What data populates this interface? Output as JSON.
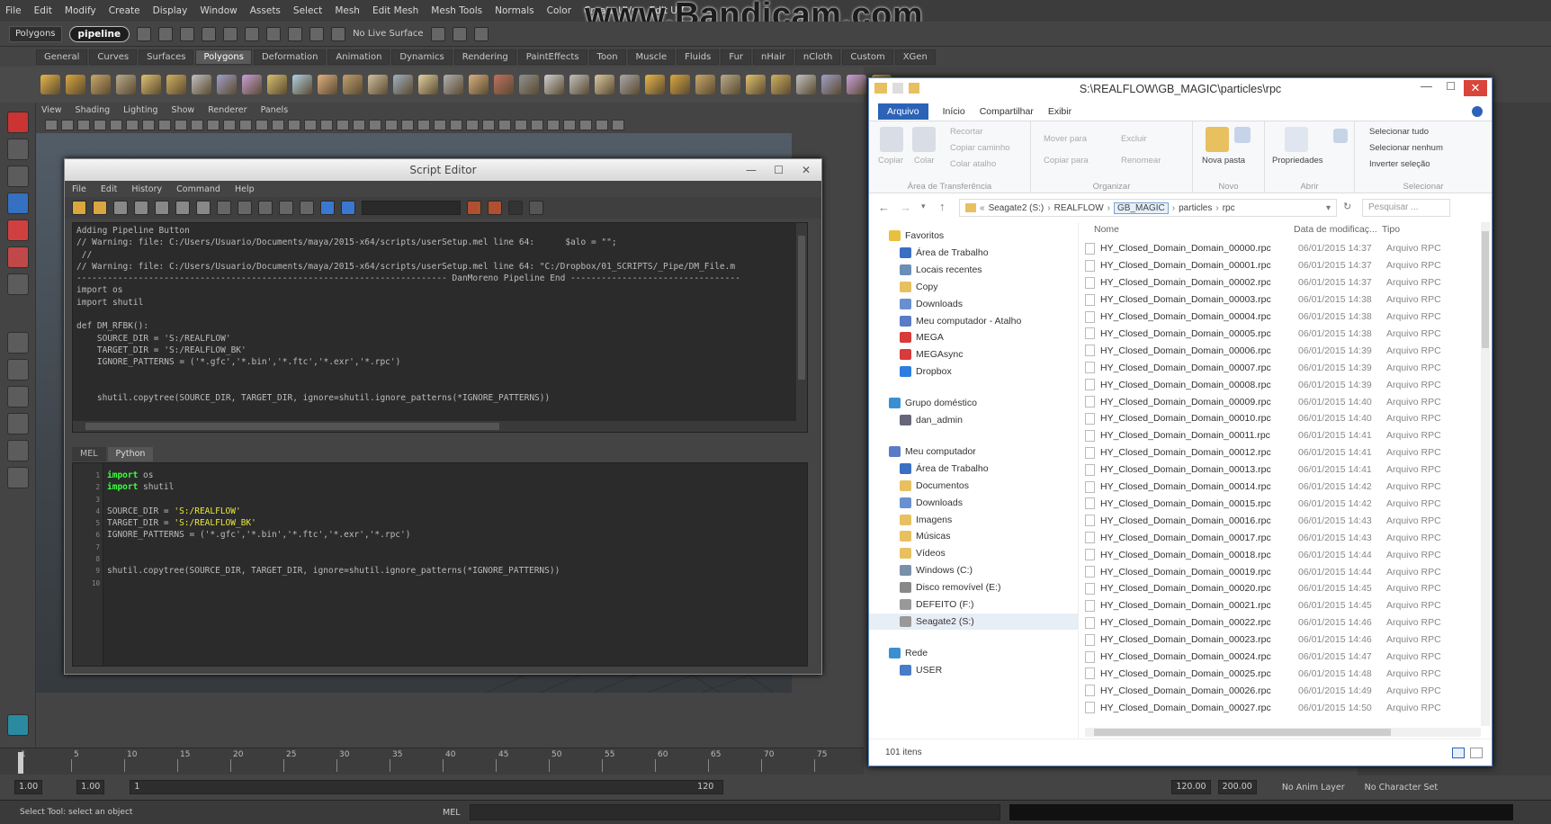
{
  "maya": {
    "menu": [
      "File",
      "Edit",
      "Modify",
      "Create",
      "Display",
      "Window",
      "Assets",
      "Select",
      "Mesh",
      "Edit Mesh",
      "Mesh Tools",
      "Normals",
      "Color",
      "Create UVs",
      "Edit UV"
    ],
    "watermark": "www.Bandicam.com",
    "mode_dropdown": "Polygons",
    "pipeline_label": "pipeline",
    "live_surface": "No Live Surface",
    "shelf_tabs": [
      "General",
      "Curves",
      "Surfaces",
      "Polygons",
      "Deformation",
      "Animation",
      "Dynamics",
      "Rendering",
      "PaintEffects",
      "Toon",
      "Muscle",
      "Fluids",
      "Fur",
      "nHair",
      "nCloth",
      "Custom",
      "XGen"
    ],
    "panel_menu": [
      "View",
      "Shading",
      "Lighting",
      "Show",
      "Renderer",
      "Panels"
    ],
    "timeline_ticks": [
      "1",
      "5",
      "10",
      "15",
      "20",
      "25",
      "30",
      "35",
      "40",
      "45",
      "50",
      "55",
      "60",
      "65",
      "70",
      "75"
    ],
    "range": {
      "start": "1.00",
      "start2": "1.00",
      "frame": "1",
      "end_marker": "120",
      "end": "120.00",
      "end2": "200.00"
    },
    "anim_layer": "No Anim Layer",
    "char_set": "No Character Set",
    "help_line": "Select Tool: select an object",
    "cmd_lang": "MEL"
  },
  "script_editor": {
    "title": "Script Editor",
    "menu": [
      "File",
      "Edit",
      "History",
      "Command",
      "Help"
    ],
    "tabs": [
      "MEL",
      "Python"
    ],
    "active_tab": "Python",
    "output": "Adding Pipeline Button\n// Warning: file: C:/Users/Usuario/Documents/maya/2015-x64/scripts/userSetup.mel line 64:      $alo = \"\";\n //\n// Warning: file: C:/Users/Usuario/Documents/maya/2015-x64/scripts/userSetup.mel line 64: \"C:/Dropbox/01_SCRIPTS/_Pipe/DM_File.m\n------------------------------------------------------------------------ DanMoreno Pipeline End ---------------------------------\nimport os\nimport shutil\n\ndef DM_RFBK():\n    SOURCE_DIR = 'S:/REALFLOW'\n    TARGET_DIR = 'S:/REALFLOW_BK'\n    IGNORE_PATTERNS = ('*.gfc','*.bin','*.ftc','*.exr','*.rpc')\n\n\n    shutil.copytree(SOURCE_DIR, TARGET_DIR, ignore=shutil.ignore_patterns(*IGNORE_PATTERNS))",
    "input_lines": [
      {
        "n": "1",
        "kw": "import",
        "rest": " os"
      },
      {
        "n": "2",
        "kw": "import",
        "rest": " shutil"
      },
      {
        "n": "3",
        "kw": "",
        "rest": ""
      },
      {
        "n": "4",
        "kw": "",
        "rest": "SOURCE_DIR = ",
        "str": "'S:/REALFLOW'"
      },
      {
        "n": "5",
        "kw": "",
        "rest": "TARGET_DIR = ",
        "str": "'S:/REALFLOW_BK'"
      },
      {
        "n": "6",
        "kw": "",
        "rest": "IGNORE_PATTERNS = ('*.gfc','*.bin','*.ftc','*.exr','*.rpc')"
      },
      {
        "n": "7",
        "kw": "",
        "rest": ""
      },
      {
        "n": "8",
        "kw": "",
        "rest": ""
      },
      {
        "n": "9",
        "kw": "",
        "rest": "shutil.copytree(SOURCE_DIR, TARGET_DIR, ignore=shutil.ignore_patterns(*IGNORE_PATTERNS))"
      },
      {
        "n": "10",
        "kw": "",
        "rest": ""
      }
    ]
  },
  "explorer": {
    "title": "S:\\REALFLOW\\GB_MAGIC\\particles\\rpc",
    "tabs": [
      "Arquivo",
      "Início",
      "Compartilhar",
      "Exibir"
    ],
    "ribbon": {
      "copiar": "Copiar",
      "colar": "Colar",
      "recortar": "Recortar",
      "copiar_caminho": "Copiar caminho",
      "colar_atalho": "Colar atalho",
      "grp_transfer": "Área de Transferência",
      "mover": "Mover para",
      "copiar_para": "Copiar para",
      "excluir": "Excluir",
      "renomear": "Renomear",
      "grp_organizar": "Organizar",
      "nova_pasta": "Nova pasta",
      "grp_novo": "Novo",
      "propriedades": "Propriedades",
      "grp_abrir": "Abrir",
      "sel_tudo": "Selecionar tudo",
      "sel_nenhum": "Selecionar nenhum",
      "inverter": "Inverter seleção",
      "grp_selecionar": "Selecionar"
    },
    "path": [
      "Seagate2 (S:)",
      "REALFLOW",
      "GB_MAGIC",
      "particles",
      "rpc"
    ],
    "search_placeholder": "Pesquisar ...",
    "nav": {
      "favoritos": "Favoritos",
      "fav_items": [
        "Área de Trabalho",
        "Locais recentes",
        "Copy",
        "Downloads",
        "Meu computador - Atalho",
        "MEGA",
        "MEGAsync",
        "Dropbox"
      ],
      "grupo": "Grupo doméstico",
      "grupo_items": [
        "dan_admin"
      ],
      "computador": "Meu computador",
      "comp_items": [
        "Área de Trabalho",
        "Documentos",
        "Downloads",
        "Imagens",
        "Músicas",
        "Vídeos",
        "Windows (C:)",
        "Disco removível (E:)",
        "DEFEITO (F:)",
        "Seagate2 (S:)"
      ],
      "rede": "Rede",
      "rede_items": [
        "USER"
      ]
    },
    "columns": [
      "Nome",
      "Data de modificaç...",
      "Tipo"
    ],
    "files": [
      {
        "name": "HY_Closed_Domain_Domain_00000.rpc",
        "date": "06/01/2015 14:37",
        "type": "Arquivo RPC"
      },
      {
        "name": "HY_Closed_Domain_Domain_00001.rpc",
        "date": "06/01/2015 14:37",
        "type": "Arquivo RPC"
      },
      {
        "name": "HY_Closed_Domain_Domain_00002.rpc",
        "date": "06/01/2015 14:37",
        "type": "Arquivo RPC"
      },
      {
        "name": "HY_Closed_Domain_Domain_00003.rpc",
        "date": "06/01/2015 14:38",
        "type": "Arquivo RPC"
      },
      {
        "name": "HY_Closed_Domain_Domain_00004.rpc",
        "date": "06/01/2015 14:38",
        "type": "Arquivo RPC"
      },
      {
        "name": "HY_Closed_Domain_Domain_00005.rpc",
        "date": "06/01/2015 14:38",
        "type": "Arquivo RPC"
      },
      {
        "name": "HY_Closed_Domain_Domain_00006.rpc",
        "date": "06/01/2015 14:39",
        "type": "Arquivo RPC"
      },
      {
        "name": "HY_Closed_Domain_Domain_00007.rpc",
        "date": "06/01/2015 14:39",
        "type": "Arquivo RPC"
      },
      {
        "name": "HY_Closed_Domain_Domain_00008.rpc",
        "date": "06/01/2015 14:39",
        "type": "Arquivo RPC"
      },
      {
        "name": "HY_Closed_Domain_Domain_00009.rpc",
        "date": "06/01/2015 14:40",
        "type": "Arquivo RPC"
      },
      {
        "name": "HY_Closed_Domain_Domain_00010.rpc",
        "date": "06/01/2015 14:40",
        "type": "Arquivo RPC"
      },
      {
        "name": "HY_Closed_Domain_Domain_00011.rpc",
        "date": "06/01/2015 14:41",
        "type": "Arquivo RPC"
      },
      {
        "name": "HY_Closed_Domain_Domain_00012.rpc",
        "date": "06/01/2015 14:41",
        "type": "Arquivo RPC"
      },
      {
        "name": "HY_Closed_Domain_Domain_00013.rpc",
        "date": "06/01/2015 14:41",
        "type": "Arquivo RPC"
      },
      {
        "name": "HY_Closed_Domain_Domain_00014.rpc",
        "date": "06/01/2015 14:42",
        "type": "Arquivo RPC"
      },
      {
        "name": "HY_Closed_Domain_Domain_00015.rpc",
        "date": "06/01/2015 14:42",
        "type": "Arquivo RPC"
      },
      {
        "name": "HY_Closed_Domain_Domain_00016.rpc",
        "date": "06/01/2015 14:43",
        "type": "Arquivo RPC"
      },
      {
        "name": "HY_Closed_Domain_Domain_00017.rpc",
        "date": "06/01/2015 14:43",
        "type": "Arquivo RPC"
      },
      {
        "name": "HY_Closed_Domain_Domain_00018.rpc",
        "date": "06/01/2015 14:44",
        "type": "Arquivo RPC"
      },
      {
        "name": "HY_Closed_Domain_Domain_00019.rpc",
        "date": "06/01/2015 14:44",
        "type": "Arquivo RPC"
      },
      {
        "name": "HY_Closed_Domain_Domain_00020.rpc",
        "date": "06/01/2015 14:45",
        "type": "Arquivo RPC"
      },
      {
        "name": "HY_Closed_Domain_Domain_00021.rpc",
        "date": "06/01/2015 14:45",
        "type": "Arquivo RPC"
      },
      {
        "name": "HY_Closed_Domain_Domain_00022.rpc",
        "date": "06/01/2015 14:46",
        "type": "Arquivo RPC"
      },
      {
        "name": "HY_Closed_Domain_Domain_00023.rpc",
        "date": "06/01/2015 14:46",
        "type": "Arquivo RPC"
      },
      {
        "name": "HY_Closed_Domain_Domain_00024.rpc",
        "date": "06/01/2015 14:47",
        "type": "Arquivo RPC"
      },
      {
        "name": "HY_Closed_Domain_Domain_00025.rpc",
        "date": "06/01/2015 14:48",
        "type": "Arquivo RPC"
      },
      {
        "name": "HY_Closed_Domain_Domain_00026.rpc",
        "date": "06/01/2015 14:49",
        "type": "Arquivo RPC"
      },
      {
        "name": "HY_Closed_Domain_Domain_00027.rpc",
        "date": "06/01/2015 14:50",
        "type": "Arquivo RPC"
      }
    ],
    "item_count": "101 itens"
  }
}
